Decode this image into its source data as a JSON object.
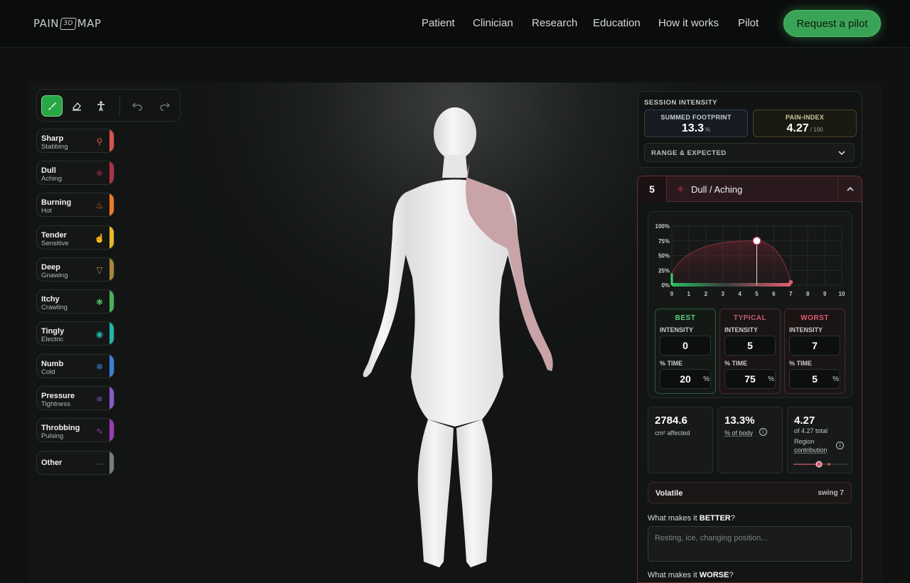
{
  "header": {
    "logo_left": "PAIN",
    "logo_box": "3D",
    "logo_right": "MAP",
    "nav": [
      "Patient",
      "Clinician",
      "Research",
      "Education",
      "How it works",
      "Pilot"
    ],
    "cta": "Request a pilot"
  },
  "toolbar": {
    "tools": [
      "brush-icon",
      "eraser-icon",
      "figure-icon",
      "undo-icon",
      "redo-icon"
    ]
  },
  "pain_types": [
    {
      "name": "Sharp",
      "sub": "Stabbing",
      "icon": "pin-icon",
      "glyph": "⚲",
      "color": "#d9534f"
    },
    {
      "name": "Dull",
      "sub": "Aching",
      "icon": "grid-icon",
      "glyph": "⁜",
      "color": "#b03048"
    },
    {
      "name": "Burning",
      "sub": "Hot",
      "icon": "flame-icon",
      "glyph": "♨",
      "color": "#f07a22"
    },
    {
      "name": "Tender",
      "sub": "Sensitive",
      "icon": "hand-icon",
      "glyph": "☝",
      "color": "#e7b92c"
    },
    {
      "name": "Deep",
      "sub": "Gnawing",
      "icon": "funnel-icon",
      "glyph": "▽",
      "color": "#a8863a"
    },
    {
      "name": "Itchy",
      "sub": "Crawling",
      "icon": "bug-icon",
      "glyph": "✱",
      "color": "#4cb05a"
    },
    {
      "name": "Tingly",
      "sub": "Electric",
      "icon": "signal-icon",
      "glyph": "◉",
      "color": "#1fb7a8"
    },
    {
      "name": "Numb",
      "sub": "Cold",
      "icon": "snowflake-icon",
      "glyph": "❄",
      "color": "#3b82d6"
    },
    {
      "name": "Pressure",
      "sub": "Tightness",
      "icon": "compress-icon",
      "glyph": "≑",
      "color": "#8d5ad0"
    },
    {
      "name": "Throbbing",
      "sub": "Pulsing",
      "icon": "pulse-icon",
      "glyph": "∿",
      "color": "#9c3cb4"
    },
    {
      "name": "Other",
      "sub": "",
      "icon": "more-icon",
      "glyph": "···",
      "color": "#7a7e7d"
    }
  ],
  "session": {
    "heading": "SESSION INTENSITY",
    "footprint_label": "SUMMED FOOTPRINT",
    "footprint_value": "13.3",
    "footprint_unit": "%",
    "index_label": "PAIN-INDEX",
    "index_value": "4.27",
    "index_unit": "/ 100",
    "range_label": "RANGE & EXPECTED"
  },
  "region": {
    "number": "5",
    "title": "Dull / Aching",
    "chart_data": {
      "type": "area",
      "x_ticks": [
        "0",
        "1",
        "2",
        "3",
        "4",
        "5",
        "6",
        "7",
        "8",
        "9",
        "10"
      ],
      "y_ticks": [
        "0%",
        "25%",
        "50%",
        "75%",
        "100%"
      ],
      "xlim": [
        0,
        10
      ],
      "ylim": [
        0,
        100
      ],
      "points": [
        {
          "x": 0,
          "y": 20,
          "label": "best"
        },
        {
          "x": 5,
          "y": 75,
          "label": "typical"
        },
        {
          "x": 7,
          "y": 5,
          "label": "worst"
        }
      ]
    },
    "best": {
      "header": "BEST",
      "intensity_label": "INTENSITY",
      "intensity": "0",
      "time_label": "% TIME",
      "time": "20",
      "pct": "%"
    },
    "typical": {
      "header": "TYPICAL",
      "intensity_label": "INTENSITY",
      "intensity": "5",
      "time_label": "% TIME",
      "time": "75",
      "pct": "%"
    },
    "worst": {
      "header": "WORST",
      "intensity_label": "INTENSITY",
      "intensity": "7",
      "time_label": "% TIME",
      "time": "5",
      "pct": "%"
    },
    "area_value": "2784.6",
    "area_label": "cm² affected",
    "body_value": "13.3%",
    "body_label": "% of body",
    "contrib_value": "4.27",
    "contrib_sub": "of 4.27 total",
    "contrib_label1": "Region",
    "contrib_label2": "contribution",
    "volatile_label": "Volatile",
    "swing_label": "swing 7",
    "better_prefix": "What makes it ",
    "better_bold": "BETTER",
    "better_suffix": "?",
    "better_placeholder": "Resting, ice, changing position...",
    "worse_prefix": "What makes it ",
    "worse_bold": "WORSE",
    "worse_suffix": "?"
  },
  "colors": {
    "accent": "#28a745",
    "region": "#c8a3a8",
    "danger": "#e0596e"
  }
}
